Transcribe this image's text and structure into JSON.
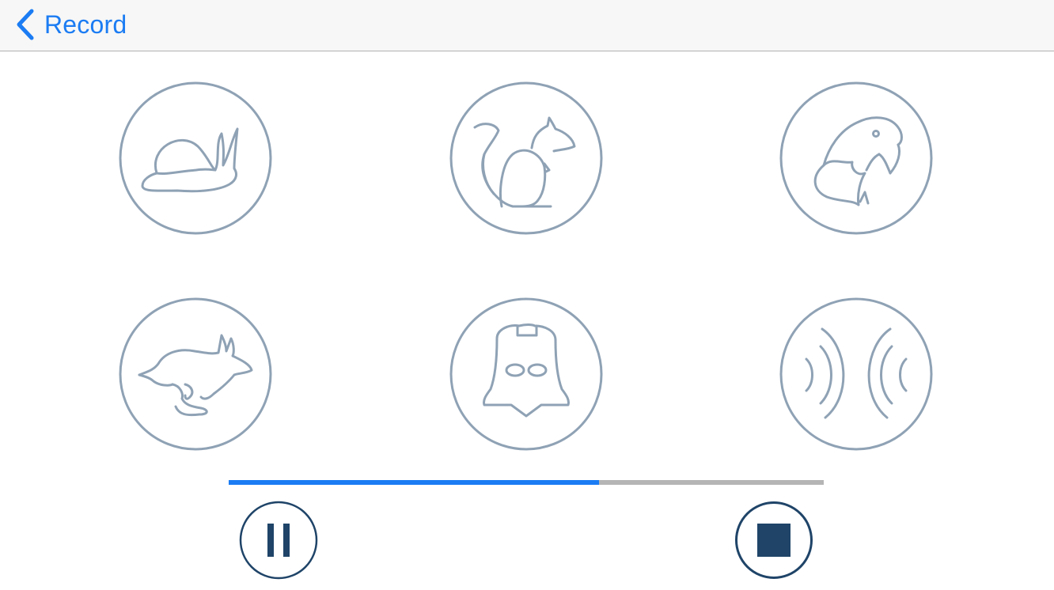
{
  "navbar": {
    "back_label": "Record",
    "back_icon": "chevron-left-icon"
  },
  "effects": [
    {
      "id": "snail",
      "icon": "snail-icon"
    },
    {
      "id": "squirrel",
      "icon": "squirrel-icon"
    },
    {
      "id": "parrot",
      "icon": "parrot-icon"
    },
    {
      "id": "rabbit",
      "icon": "rabbit-icon"
    },
    {
      "id": "darth-vader",
      "icon": "darth-vader-icon"
    },
    {
      "id": "echo",
      "icon": "echo-icon"
    }
  ],
  "playback": {
    "progress_fraction": 0.623,
    "pause_icon": "pause-icon",
    "stop_icon": "stop-icon"
  },
  "colors": {
    "accent": "#1b7cf3",
    "effect_stroke": "#8fa2b5",
    "control_dark": "#1f4468",
    "progress_track": "#b5b5b5",
    "navbar_bg": "#f7f7f7"
  }
}
